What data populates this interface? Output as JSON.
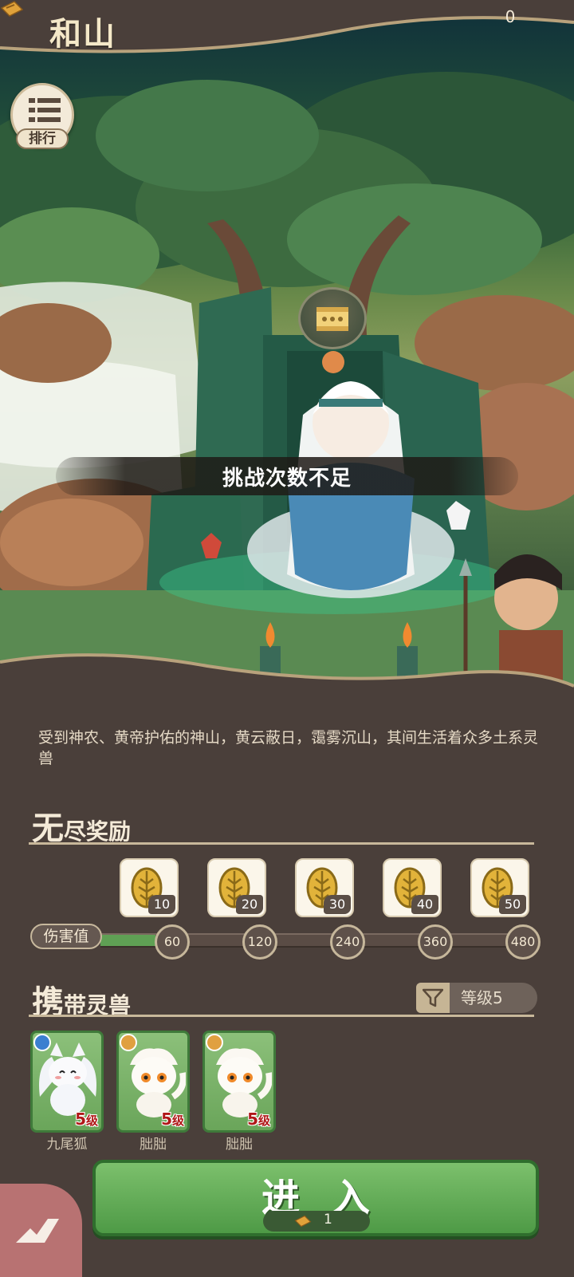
{
  "header": {
    "title": "和山",
    "ticket_count": "0",
    "ticket_icon": "ticket-icon"
  },
  "ranking": {
    "label": "排行",
    "icon": "list-icon"
  },
  "dialog_icon": "scroll-icon",
  "toast": "挑战次数不足",
  "description": "受到神农、黄帝护佑的神山，黄云蔽日，霭雾沉山，其间生活着众多土系灵兽",
  "rewards_section": {
    "title_big": "无",
    "title_small": "尽奖励",
    "items": [
      {
        "icon": "leaf-coin-icon",
        "qty": "10"
      },
      {
        "icon": "leaf-coin-icon",
        "qty": "20"
      },
      {
        "icon": "leaf-coin-icon",
        "qty": "30"
      },
      {
        "icon": "leaf-coin-icon",
        "qty": "40"
      },
      {
        "icon": "leaf-coin-icon",
        "qty": "50"
      }
    ],
    "damage_label": "伤害值",
    "progress_fraction": 0.13,
    "milestones": [
      "60",
      "120",
      "240",
      "360",
      "480"
    ]
  },
  "pets_section": {
    "title_big": "携",
    "title_small": "带灵兽",
    "filter_label": "等级5",
    "pets": [
      {
        "name": "九尾狐",
        "level": "5",
        "level_unit": "级",
        "badge": "snowflake-icon"
      },
      {
        "name": "朏朏",
        "level": "5",
        "level_unit": "级",
        "badge": "sun-icon"
      },
      {
        "name": "朏朏",
        "level": "5",
        "level_unit": "级",
        "badge": "sun-icon"
      }
    ]
  },
  "enter_button": {
    "label": "进入",
    "cost": "1",
    "cost_icon": "ticket-icon"
  },
  "colors": {
    "background": "#4a3f3a",
    "accent_green": "#5fa054",
    "text_light": "#f4ead8"
  }
}
